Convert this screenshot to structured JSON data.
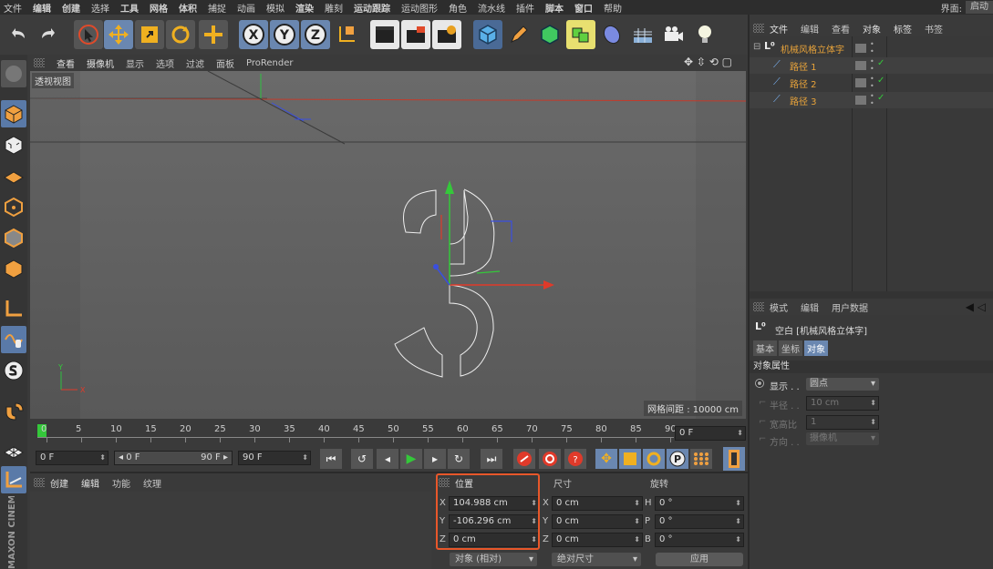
{
  "menu": {
    "items": [
      "文件",
      "编辑",
      "创建",
      "选择",
      "工具",
      "网格",
      "体积",
      "捕捉",
      "动画",
      "模拟",
      "渲染",
      "雕刻",
      "运动跟踪",
      "运动图形",
      "角色",
      "流水线",
      "插件",
      "脚本",
      "窗口",
      "帮助"
    ],
    "layout_label": "界面:",
    "layout_value": "启动"
  },
  "toolbar_icons": [
    "undo-icon",
    "redo-icon",
    "live-select-icon",
    "move-icon",
    "scale-icon",
    "rotate-icon",
    "create-icon",
    "x-axis-icon",
    "y-axis-icon",
    "z-axis-icon",
    "coord-system-icon",
    "render-view-icon",
    "render-queue-icon",
    "render-settings-icon",
    "cube-icon",
    "pen-icon",
    "subdivision-icon",
    "cloner-icon",
    "deformer-icon",
    "floor-icon",
    "camera-icon",
    "light-icon"
  ],
  "axis_letters": {
    "x": "X",
    "y": "Y",
    "z": "Z"
  },
  "viewport": {
    "tabs": [
      "查看",
      "摄像机",
      "显示",
      "选项",
      "过滤",
      "面板",
      "ProRender"
    ],
    "name": "透视视图",
    "grid_spacing": "网格间距 : 10000 cm",
    "axis_x": "X",
    "axis_y": "Y"
  },
  "timeline": {
    "ticks": [
      "0",
      "5",
      "10",
      "15",
      "20",
      "25",
      "30",
      "35",
      "40",
      "45",
      "50",
      "55",
      "60",
      "65",
      "70",
      "75",
      "80",
      "85",
      "90"
    ],
    "current_frame": "0 F"
  },
  "transport": {
    "start": "0 F",
    "range_start": "◂ 0 F",
    "range_end": "90 F ▸",
    "end": "90 F"
  },
  "material": {
    "tabs": [
      "创建",
      "编辑",
      "功能",
      "纹理"
    ]
  },
  "coords": {
    "header_pos": "位置",
    "header_size": "尺寸",
    "header_rot": "旋转",
    "pos": [
      {
        "axis": "X",
        "value": "104.988 cm"
      },
      {
        "axis": "Y",
        "value": "-106.296 cm"
      },
      {
        "axis": "Z",
        "value": "0 cm"
      }
    ],
    "size": [
      {
        "axis": "X",
        "value": "0 cm"
      },
      {
        "axis": "Y",
        "value": "0 cm"
      },
      {
        "axis": "Z",
        "value": "0 cm"
      }
    ],
    "rot": [
      {
        "axis": "H",
        "value": "0 °"
      },
      {
        "axis": "P",
        "value": "0 °"
      },
      {
        "axis": "B",
        "value": "0 °"
      }
    ],
    "mode": "对象 (相对)",
    "size_mode": "绝对尺寸",
    "apply": "应用"
  },
  "objects": {
    "tabs": [
      "文件",
      "编辑",
      "查看",
      "对象",
      "标签",
      "书签"
    ],
    "root": "机械风格立体字",
    "children": [
      "路径 1",
      "路径 2",
      "路径 3"
    ]
  },
  "attributes": {
    "tabs": [
      "模式",
      "编辑",
      "用户数据"
    ],
    "title": "空白 [机械风格立体字]",
    "subtabs": [
      "基本",
      "坐标",
      "对象"
    ],
    "section": "对象属性",
    "props": [
      {
        "label": "显示 . .",
        "value": "圆点"
      },
      {
        "label": "半径 . .",
        "value": "10 cm"
      },
      {
        "label": "宽高比",
        "value": "1"
      },
      {
        "label": "方向 . .",
        "value": "摄像机"
      }
    ]
  },
  "brand": "MAXON CINEMA 4D",
  "colors": {
    "x_axis": "#e03a2a",
    "y_axis": "#34c83a",
    "z_axis": "#3a4fe0",
    "highlight": "#e8572a",
    "orange_text": "#e8a33a"
  }
}
